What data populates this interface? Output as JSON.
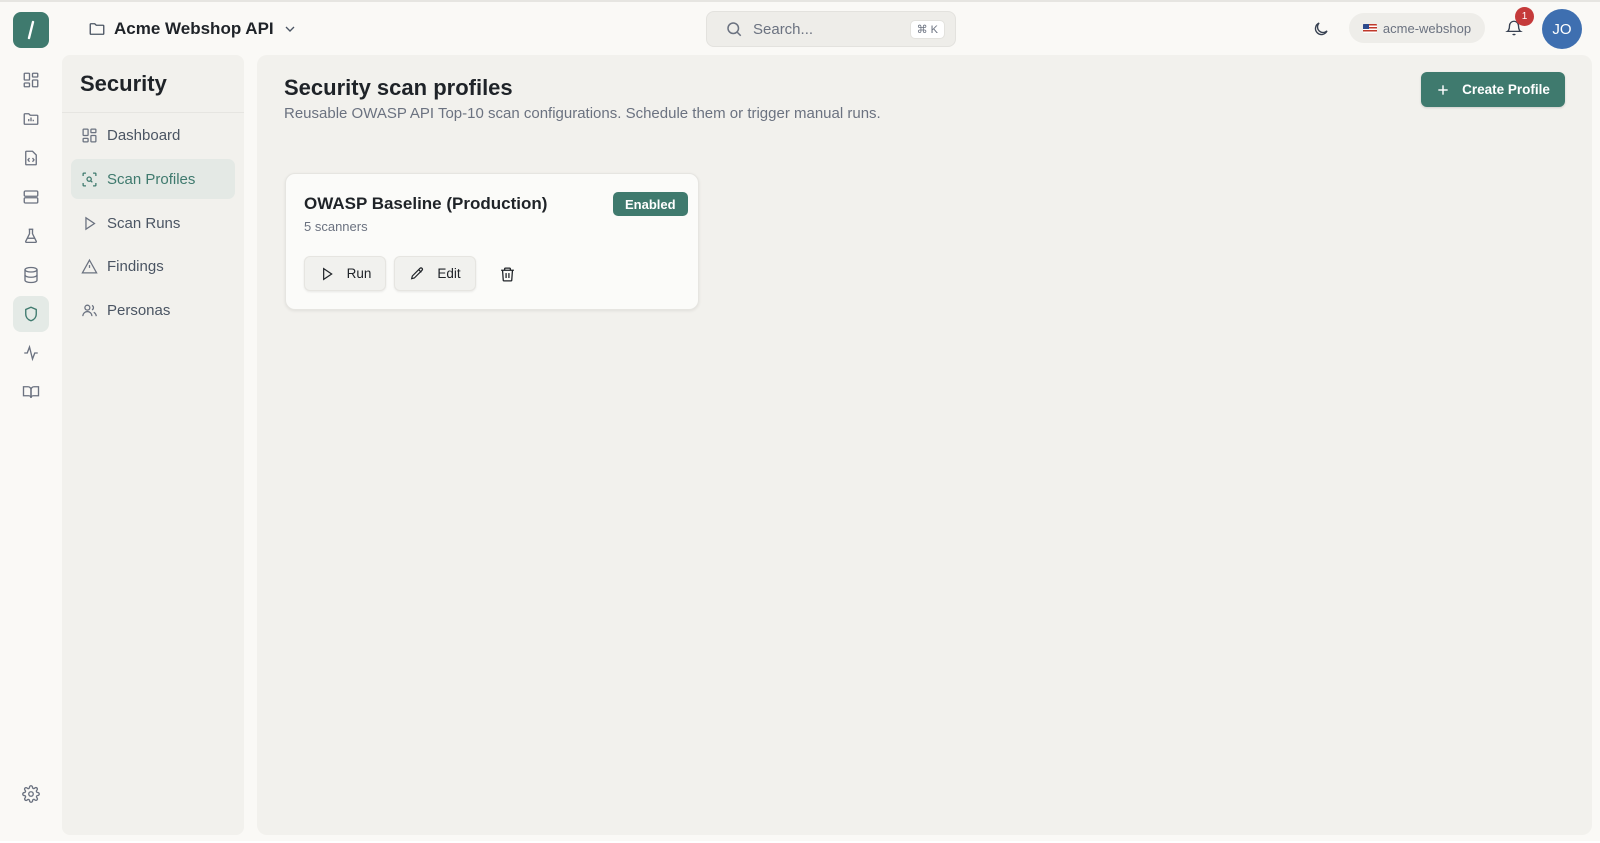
{
  "header": {
    "project_name": "Acme Webshop API",
    "search_placeholder": "Search...",
    "search_shortcut": "⌘ K",
    "workspace": "acme-webshop",
    "notification_count": "1",
    "user_initials": "JO"
  },
  "rail": {
    "items": [
      {
        "icon": "dashboard-grid-icon"
      },
      {
        "icon": "folder-chart-icon"
      },
      {
        "icon": "code-file-icon"
      },
      {
        "icon": "server-icon"
      },
      {
        "icon": "flask-icon"
      },
      {
        "icon": "database-icon"
      },
      {
        "icon": "shield-icon",
        "active": true
      },
      {
        "icon": "activity-icon"
      },
      {
        "icon": "book-icon"
      }
    ],
    "settings_icon": "gear-icon"
  },
  "section": {
    "title": "Security",
    "items": [
      {
        "label": "Dashboard",
        "icon": "dashboard-grid-icon"
      },
      {
        "label": "Scan Profiles",
        "icon": "scan-icon",
        "active": true
      },
      {
        "label": "Scan Runs",
        "icon": "play-icon"
      },
      {
        "label": "Findings",
        "icon": "warning-triangle-icon"
      },
      {
        "label": "Personas",
        "icon": "users-icon"
      }
    ]
  },
  "main": {
    "title": "Security scan profiles",
    "subtitle": "Reusable OWASP API Top-10 scan configurations. Schedule them or trigger manual runs.",
    "create_button_label": "Create Profile",
    "profiles": [
      {
        "name": "OWASP Baseline (Production)",
        "scanners": "5 scanners",
        "status": "Enabled",
        "run_label": "Run",
        "edit_label": "Edit"
      }
    ]
  },
  "colors": {
    "accent": "#3f7a6e",
    "notification_badge": "#c53a3a",
    "avatar": "#3e6fb0"
  }
}
